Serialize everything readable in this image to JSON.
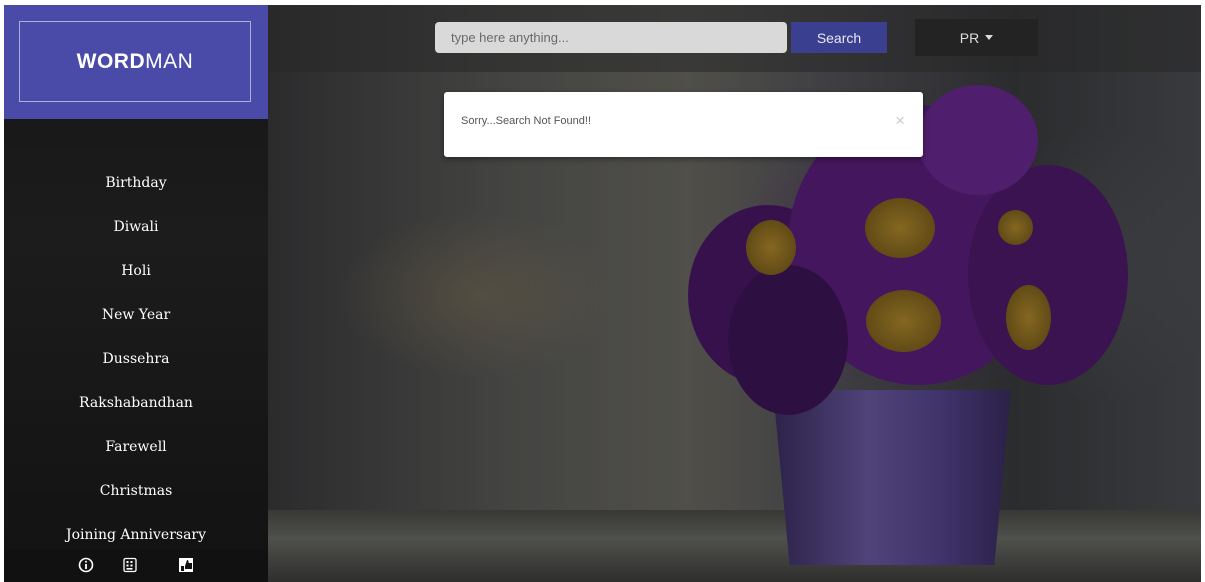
{
  "brand": {
    "bold": "WORD",
    "light": "MAN"
  },
  "sidebar": {
    "items": [
      {
        "label": "Birthday"
      },
      {
        "label": "Diwali"
      },
      {
        "label": "Holi"
      },
      {
        "label": "New Year"
      },
      {
        "label": "Dussehra"
      },
      {
        "label": "Rakshabandhan"
      },
      {
        "label": "Farewell"
      },
      {
        "label": "Christmas"
      },
      {
        "label": "Joining Anniversary"
      }
    ],
    "bottom_icons": [
      "info-icon",
      "keyboard-icon",
      "thumbs-up-icon"
    ]
  },
  "search": {
    "placeholder": "type here anything...",
    "button_label": "Search"
  },
  "language": {
    "selected": "PR"
  },
  "alert": {
    "message": "Sorry...Search Not Found!!",
    "close": "×"
  },
  "colors": {
    "brand": "#4a4aa8",
    "search_button": "#3a3f8f",
    "sidebar": "#151515"
  }
}
